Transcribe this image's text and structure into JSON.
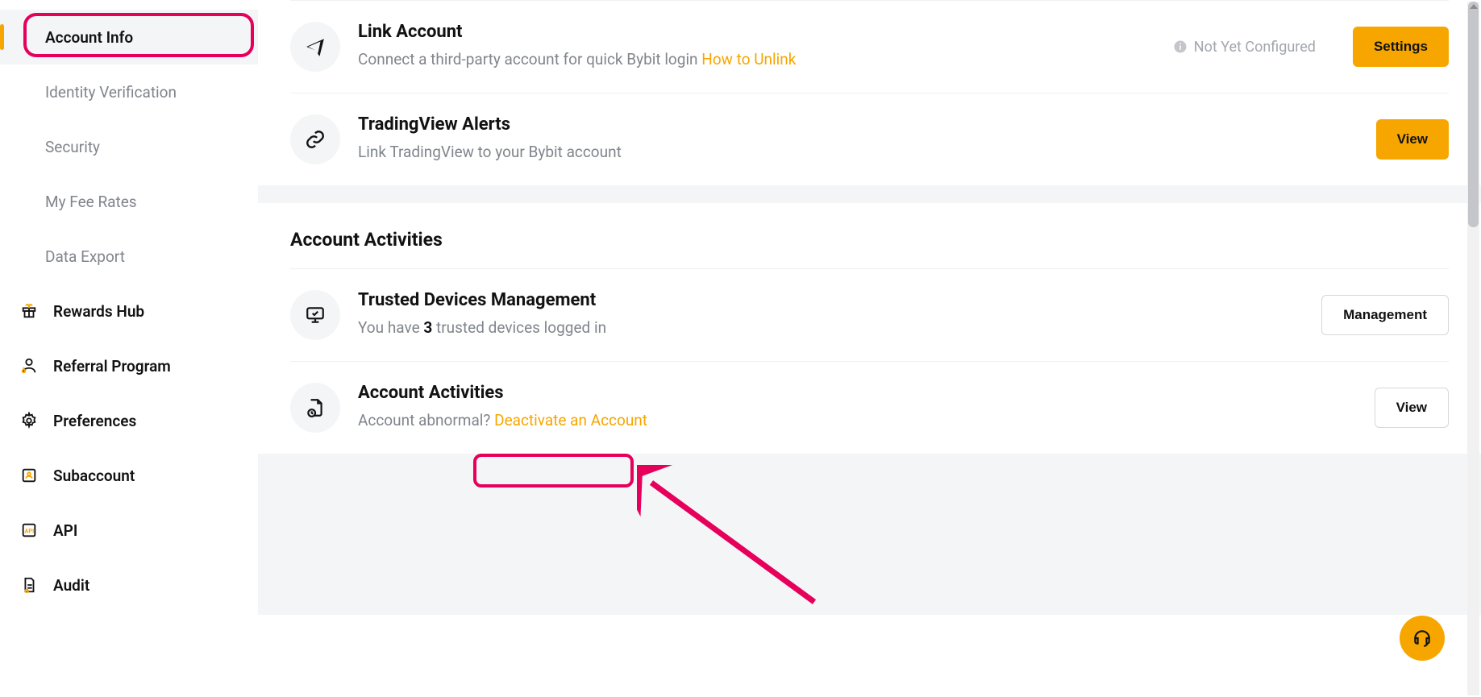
{
  "sidebar": {
    "sub_items": [
      {
        "label": "Account Info",
        "active": true
      },
      {
        "label": "Identity Verification"
      },
      {
        "label": "Security"
      },
      {
        "label": "My Fee Rates"
      },
      {
        "label": "Data Export"
      }
    ],
    "top_items": [
      {
        "label": "Rewards Hub"
      },
      {
        "label": "Referral Program"
      },
      {
        "label": "Preferences"
      },
      {
        "label": "Subaccount"
      },
      {
        "label": "API"
      },
      {
        "label": "Audit"
      }
    ]
  },
  "main": {
    "link_account": {
      "title": "Link Account",
      "desc": "Connect a third-party account for quick Bybit login",
      "link": "How to Unlink",
      "status": "Not Yet Configured",
      "button": "Settings"
    },
    "tradingview": {
      "title": "TradingView Alerts",
      "desc": "Link TradingView to your Bybit account",
      "button": "View"
    },
    "activities_section_title": "Account Activities",
    "trusted_devices": {
      "title": "Trusted Devices Management",
      "desc_pre": "You have ",
      "count": "3",
      "desc_post": " trusted devices logged in",
      "button": "Management"
    },
    "account_activities": {
      "title": "Account Activities",
      "desc": "Account abnormal?",
      "link": "Deactivate an Account",
      "button": "View"
    }
  }
}
